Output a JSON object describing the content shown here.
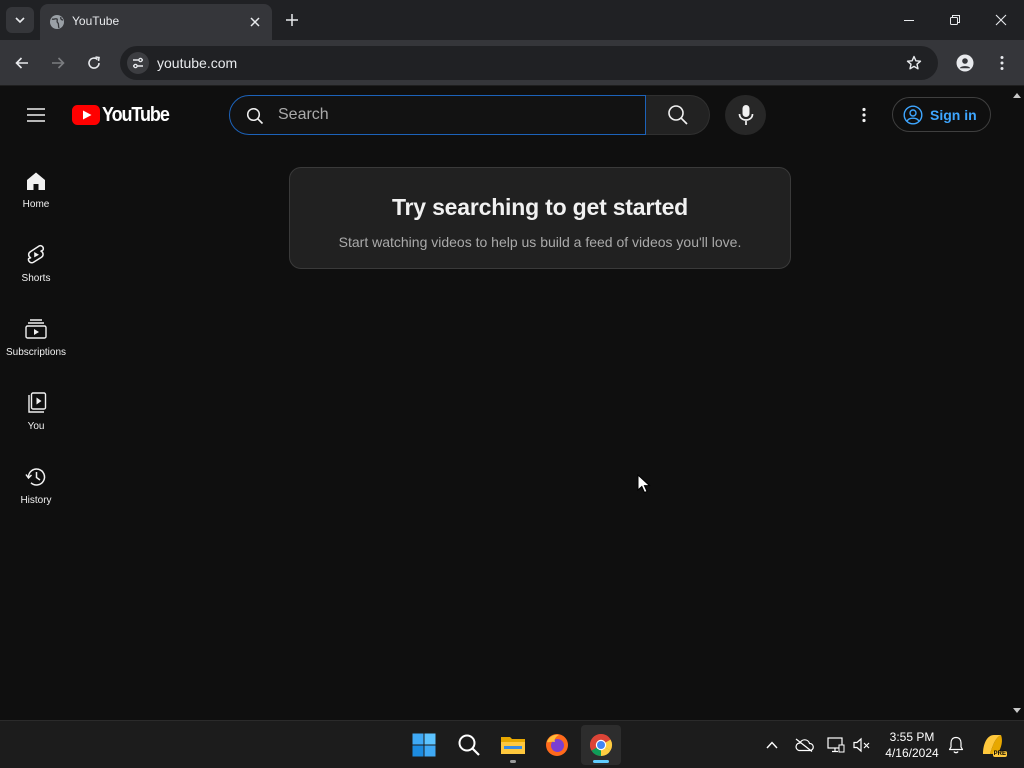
{
  "browser": {
    "tab_title": "YouTube",
    "url": "youtube.com",
    "theme": {
      "tabstrip": "#202124",
      "toolbar": "#35363a",
      "omnibox": "#202124"
    }
  },
  "youtube": {
    "brand_red": "#ff0000",
    "logo_text": "YouTube",
    "search": {
      "placeholder": "Search"
    },
    "signin_label": "Sign in",
    "accent_blue": "#3ea6ff",
    "nav": [
      {
        "label": "Home",
        "icon": "home-icon"
      },
      {
        "label": "Shorts",
        "icon": "shorts-icon"
      },
      {
        "label": "Subscriptions",
        "icon": "subscriptions-icon"
      },
      {
        "label": "You",
        "icon": "you-icon"
      },
      {
        "label": "History",
        "icon": "history-icon"
      }
    ],
    "prompt": {
      "title": "Try searching to get started",
      "subtitle": "Start watching videos to help us build a feed of videos you'll love."
    }
  },
  "taskbar": {
    "apps": [
      {
        "name": "Start",
        "icon": "windows-start-icon"
      },
      {
        "name": "Search",
        "icon": "search-icon"
      },
      {
        "name": "File Explorer",
        "icon": "file-explorer-icon"
      },
      {
        "name": "Firefox",
        "icon": "firefox-icon"
      },
      {
        "name": "Chrome",
        "icon": "chrome-icon",
        "active": true
      }
    ],
    "time": "3:55 PM",
    "date": "4/16/2024",
    "tray_badge": "PRE"
  }
}
